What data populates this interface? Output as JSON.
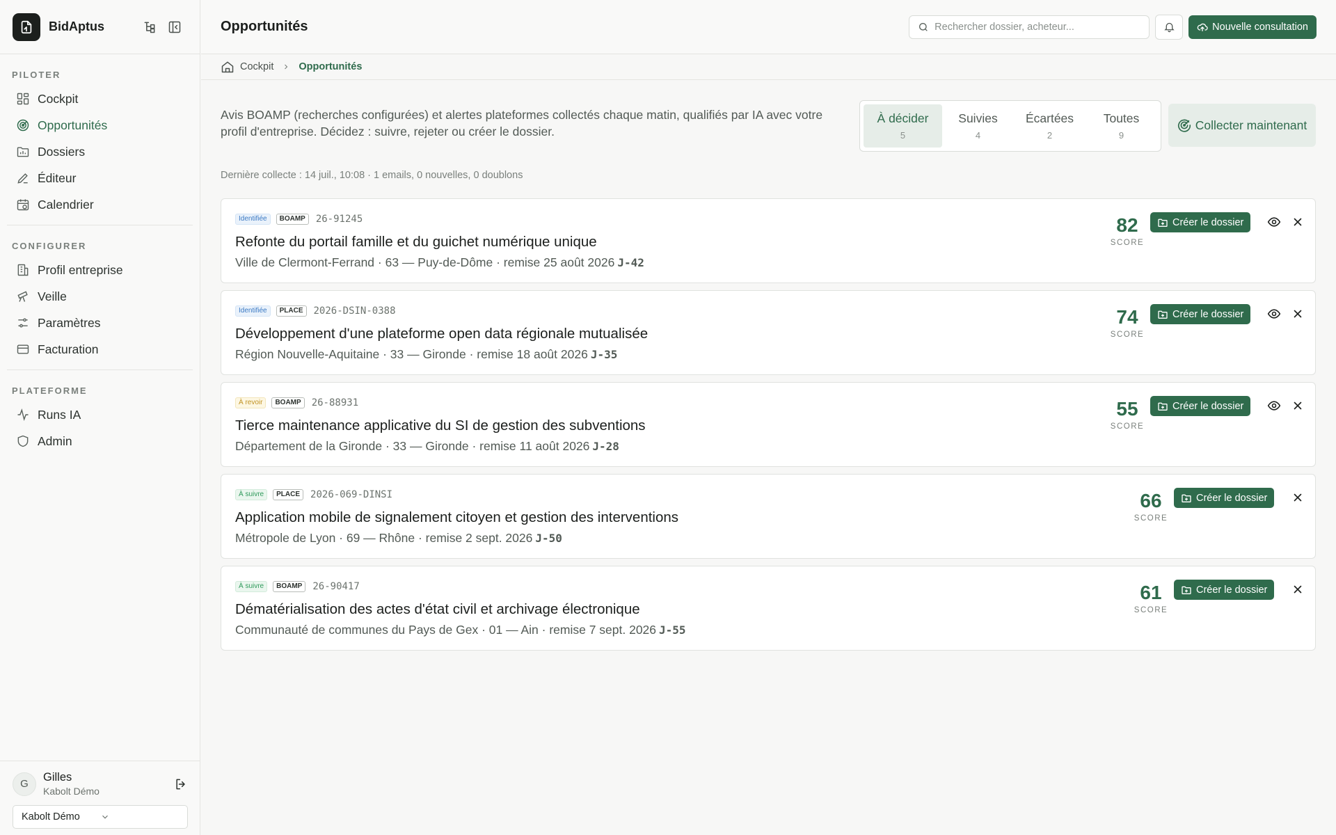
{
  "app": {
    "name": "BidAptus"
  },
  "sidebar": {
    "sections": [
      {
        "title": "PILOTER",
        "items": [
          {
            "label": "Cockpit",
            "icon": "grid-icon",
            "active": false
          },
          {
            "label": "Opportunités",
            "icon": "target-icon",
            "active": true
          },
          {
            "label": "Dossiers",
            "icon": "folder-icon",
            "active": false
          },
          {
            "label": "Éditeur",
            "icon": "pen-icon",
            "active": false
          },
          {
            "label": "Calendrier",
            "icon": "calendar-icon",
            "active": false
          }
        ]
      },
      {
        "title": "CONFIGURER",
        "items": [
          {
            "label": "Profil entreprise",
            "icon": "building-icon",
            "active": false
          },
          {
            "label": "Veille",
            "icon": "telescope-icon",
            "active": false
          },
          {
            "label": "Paramètres",
            "icon": "sliders-icon",
            "active": false
          },
          {
            "label": "Facturation",
            "icon": "credit-card-icon",
            "active": false
          }
        ]
      },
      {
        "title": "PLATEFORME",
        "items": [
          {
            "label": "Runs IA",
            "icon": "activity-icon",
            "active": false
          },
          {
            "label": "Admin",
            "icon": "shield-icon",
            "active": false
          }
        ]
      }
    ],
    "user": {
      "initial": "G",
      "name": "Gilles",
      "org": "Kabolt Démo"
    },
    "org_select": "Kabolt Démo"
  },
  "topbar": {
    "title": "Opportunités",
    "search_placeholder": "Rechercher dossier, acheteur...",
    "new_button": "Nouvelle consultation"
  },
  "breadcrumb": {
    "home": "Cockpit",
    "current": "Opportunités"
  },
  "main": {
    "intro": "Avis BOAMP (recherches configurées) et alertes plateformes collectés chaque matin, qualifiés par IA avec votre profil d'entreprise. Décidez : suivre, rejeter ou créer le dossier.",
    "tabs": [
      {
        "label": "À décider",
        "count": "5",
        "active": true
      },
      {
        "label": "Suivies",
        "count": "4",
        "active": false
      },
      {
        "label": "Écartées",
        "count": "2",
        "active": false
      },
      {
        "label": "Toutes",
        "count": "9",
        "active": false
      }
    ],
    "collect_button": "Collecter maintenant",
    "last_collect": "Dernière collecte : 14 juil., 10:08 · 1 emails, 0 nouvelles, 0 doublons",
    "score_label": "SCORE",
    "create_label": "Créer le dossier",
    "accent": "#2f6b4c",
    "opportunities": [
      {
        "status": "Identifiée",
        "status_color": "blue",
        "source": "BOAMP",
        "ref": "26-91245",
        "title": "Refonte du portail famille et du guichet numérique unique",
        "subtitle": "Ville de Clermont-Ferrand · 63 — Puy-de-Dôme · remise 25 août 2026",
        "deadline": "J-42",
        "score": "82",
        "has_view": true
      },
      {
        "status": "Identifiée",
        "status_color": "blue",
        "source": "PLACE",
        "ref": "2026-DSIN-0388",
        "title": "Développement d'une plateforme open data régionale mutualisée",
        "subtitle": "Région Nouvelle-Aquitaine · 33 — Gironde · remise 18 août 2026",
        "deadline": "J-35",
        "score": "74",
        "has_view": true
      },
      {
        "status": "À revoir",
        "status_color": "yellow",
        "source": "BOAMP",
        "ref": "26-88931",
        "title": "Tierce maintenance applicative du SI de gestion des subventions",
        "subtitle": "Département de la Gironde · 33 — Gironde · remise 11 août 2026",
        "deadline": "J-28",
        "score": "55",
        "has_view": true
      },
      {
        "status": "À suivre",
        "status_color": "green",
        "source": "PLACE",
        "ref": "2026-069-DINSI",
        "title": "Application mobile de signalement citoyen et gestion des interventions",
        "subtitle": "Métropole de Lyon · 69 — Rhône · remise 2 sept. 2026",
        "deadline": "J-50",
        "score": "66",
        "has_view": false
      },
      {
        "status": "À suivre",
        "status_color": "green",
        "source": "BOAMP",
        "ref": "26-90417",
        "title": "Dématérialisation des actes d'état civil et archivage électronique",
        "subtitle": "Communauté de communes du Pays de Gex · 01 — Ain · remise 7 sept. 2026",
        "deadline": "J-55",
        "score": "61",
        "has_view": false
      }
    ]
  }
}
